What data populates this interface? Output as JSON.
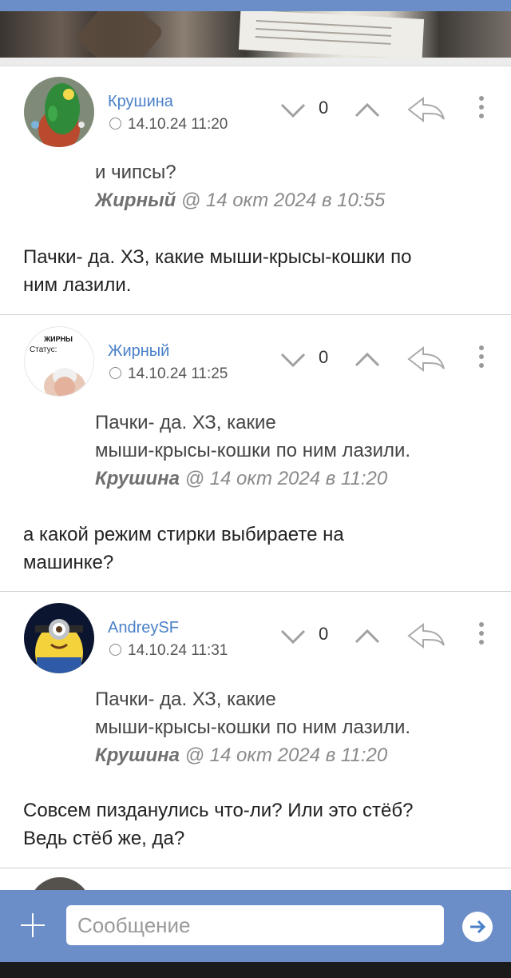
{
  "colors": {
    "accent": "#4a80c8",
    "bar": "#6b8ec9",
    "quote_author": "#8a8a8a"
  },
  "comments": [
    {
      "author": "Крушина",
      "date": "14.10.24 11:20",
      "score": "0",
      "avatar": "cactus-avatar",
      "quote": {
        "text": [
          "и чипсы?"
        ],
        "by": "Жирный",
        "meta": " @ 14 окт 2024 в 10:55"
      },
      "body": [
        "Пачки- да. ХЗ, какие мыши-крысы-кошки по",
        "ним лазили."
      ]
    },
    {
      "author": "Жирный",
      "date": "14.10.24 11:25",
      "score": "0",
      "avatar": "baby-avatar",
      "avatar_text": {
        "top": "ЖИРНЫ",
        "status": "Статус:"
      },
      "quote": {
        "text": [
          "Пачки- да. ХЗ, какие",
          "мыши-крысы-кошки по ним лазили."
        ],
        "by": "Крушина",
        "meta": " @ 14 окт 2024 в 11:20"
      },
      "body": [
        "а какой режим стирки выбираете на",
        "машинке?"
      ]
    },
    {
      "author": "AndreySF",
      "date": "14.10.24 11:31",
      "score": "0",
      "avatar": "minion-avatar",
      "quote": {
        "text": [
          "Пачки- да. ХЗ, какие",
          "мыши-крысы-кошки по ним лазили."
        ],
        "by": "Крушина",
        "meta": " @ 14 окт 2024 в 11:20"
      },
      "body": [
        "Совсем пизданулись что-ли? Или это стёб?",
        "Ведь стёб же, да?"
      ]
    }
  ],
  "composer": {
    "placeholder": "Сообщение",
    "attach_icon": "plus-icon",
    "send_icon": "send-arrow-icon"
  }
}
